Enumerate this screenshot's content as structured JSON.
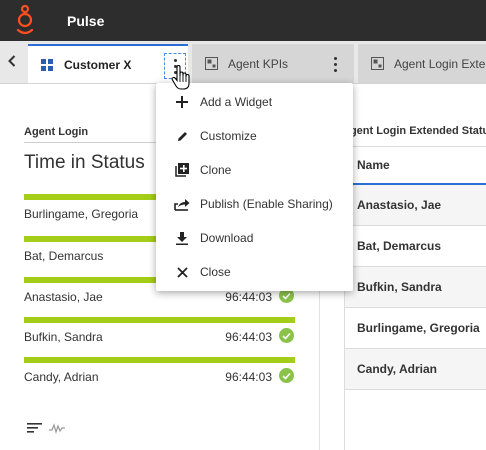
{
  "app": {
    "title": "Pulse"
  },
  "tabs": [
    {
      "label": "Customer X",
      "icon": "dashboard-grid-icon",
      "active": true
    },
    {
      "label": "Agent KPIs",
      "icon": "dashboard-icon"
    },
    {
      "label": "Agent Login Exte",
      "icon": "dashboard-icon"
    }
  ],
  "left_widget": {
    "heading": "Agent Login",
    "title": "Time in Status",
    "agents": [
      {
        "name": "Burlingame, Gregoria",
        "time": ""
      },
      {
        "name": "Bat, Demarcus",
        "time": ""
      },
      {
        "name": "Anastasio, Jae",
        "time": "96:44:03"
      },
      {
        "name": "Bufkin, Sandra",
        "time": "96:44:03"
      },
      {
        "name": "Candy, Adrian",
        "time": "96:44:03"
      }
    ]
  },
  "right_widget": {
    "heading": "Agent Login Extended Status",
    "column_header": "Name",
    "rows": [
      "Anastasio, Jae",
      "Bat, Demarcus",
      "Bufkin, Sandra",
      "Burlingame, Gregoria",
      "Candy, Adrian"
    ]
  },
  "menu": {
    "items": [
      {
        "label": "Add a Widget",
        "icon": "plus-icon"
      },
      {
        "label": "Customize",
        "icon": "pencil-icon"
      },
      {
        "label": "Clone",
        "icon": "clone-icon"
      },
      {
        "label": "Publish (Enable Sharing)",
        "icon": "share-icon"
      },
      {
        "label": "Download",
        "icon": "download-icon"
      },
      {
        "label": "Close",
        "icon": "close-icon"
      }
    ]
  },
  "colors": {
    "accent": "#2b6fd6",
    "brand": "#ff4f1f",
    "bar": "#a4cd18",
    "status_ok": "#8bc34a",
    "topbar": "#2d2d2d"
  }
}
